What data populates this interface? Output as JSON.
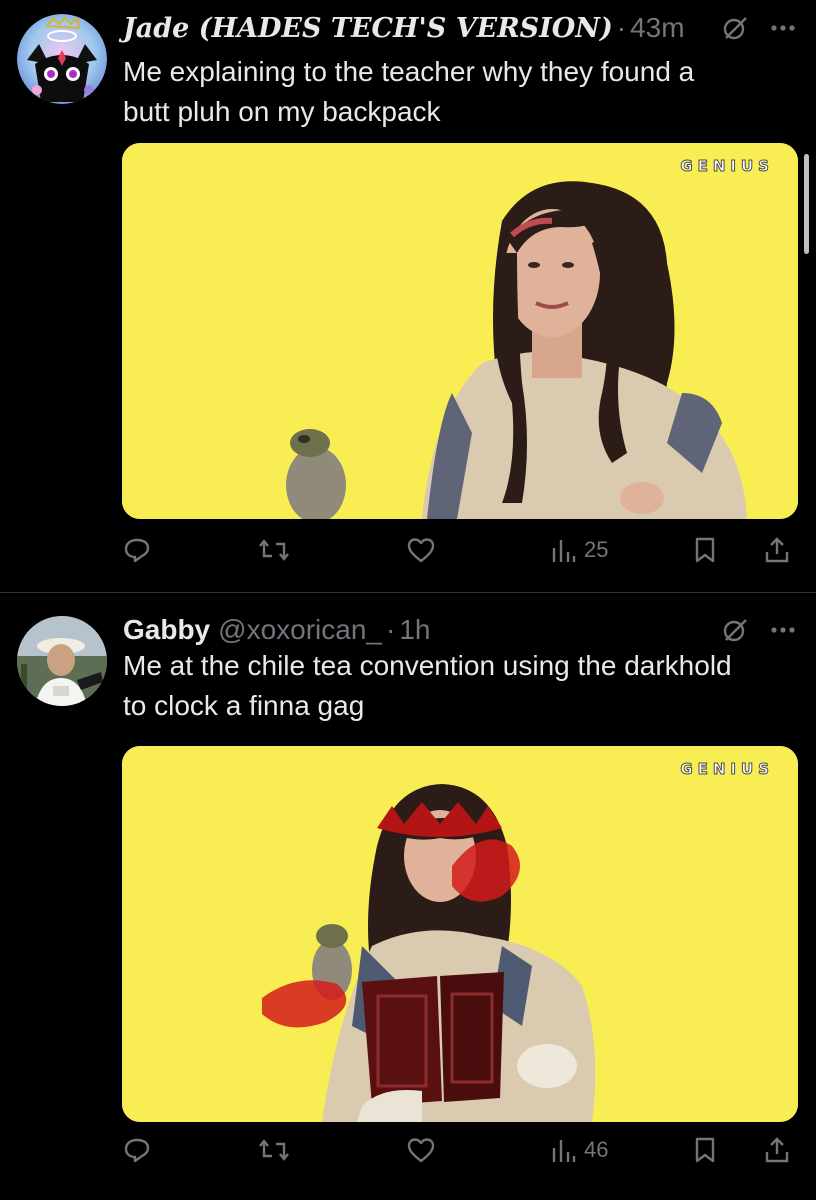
{
  "posts": [
    {
      "display_name": "Jade (HADES TECH'S VERSION)",
      "handle": "",
      "separator": "·",
      "time": "43m",
      "text_lines": [
        "Me explaining to the teacher why they found a",
        "butt pluh on my backpack"
      ],
      "media_watermark": "GENIUS",
      "views": "25",
      "icons": {
        "avatar": "cat-halo-avatar",
        "grok": "grok-icon",
        "more": "more-dots-icon",
        "reply": "reply-icon",
        "repost": "repost-icon",
        "like": "heart-icon",
        "views": "views-bar-chart-icon",
        "bookmark": "bookmark-icon",
        "share": "share-icon"
      }
    },
    {
      "display_name": "Gabby",
      "handle": "@xoxorican_",
      "separator": "·",
      "time": "1h",
      "text_lines": [
        "Me at the chile tea convention using the darkhold",
        "to clock a finna gag"
      ],
      "media_watermark": "GENIUS",
      "views": "46",
      "icons": {
        "avatar": "user-photo-avatar",
        "grok": "grok-icon",
        "more": "more-dots-icon",
        "reply": "reply-icon",
        "repost": "repost-icon",
        "like": "heart-icon",
        "views": "views-bar-chart-icon",
        "bookmark": "bookmark-icon",
        "share": "share-icon"
      }
    }
  ],
  "colors": {
    "background": "#000000",
    "text_primary": "#e7e9ea",
    "text_secondary": "#71767b",
    "media_background": "#f8ee53",
    "divider": "#2f3336"
  }
}
